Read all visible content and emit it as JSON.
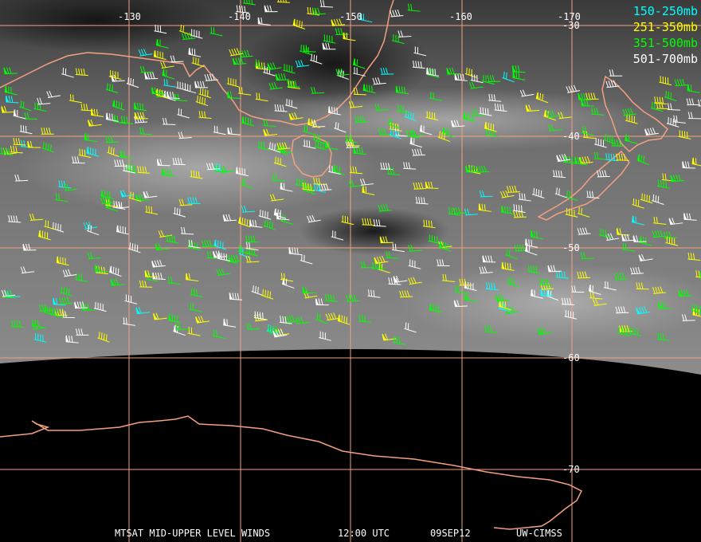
{
  "map": {
    "longitude_labels": [
      "-130",
      "-140",
      "-150",
      "-160",
      "-170"
    ],
    "latitude_labels": [
      "-30",
      "-40",
      "-50",
      "-60",
      "-70"
    ],
    "colors": {
      "grid": "#f4a080",
      "coast": "#f4a080",
      "background": "#000000",
      "tick_text": "#ffffff"
    }
  },
  "legend": [
    {
      "label": "150-250mb",
      "color": "#00ffff"
    },
    {
      "label": "251-350mb",
      "color": "#ffff00"
    },
    {
      "label": "351-500mb",
      "color": "#00ff00"
    },
    {
      "label": "501-700mb",
      "color": "#ffffff"
    }
  ],
  "footer": {
    "product": "MTSAT MID-UPPER LEVEL WINDS",
    "time": "12:00 UTC",
    "date": "09SEP12",
    "credit": "UW-CIMSS"
  }
}
